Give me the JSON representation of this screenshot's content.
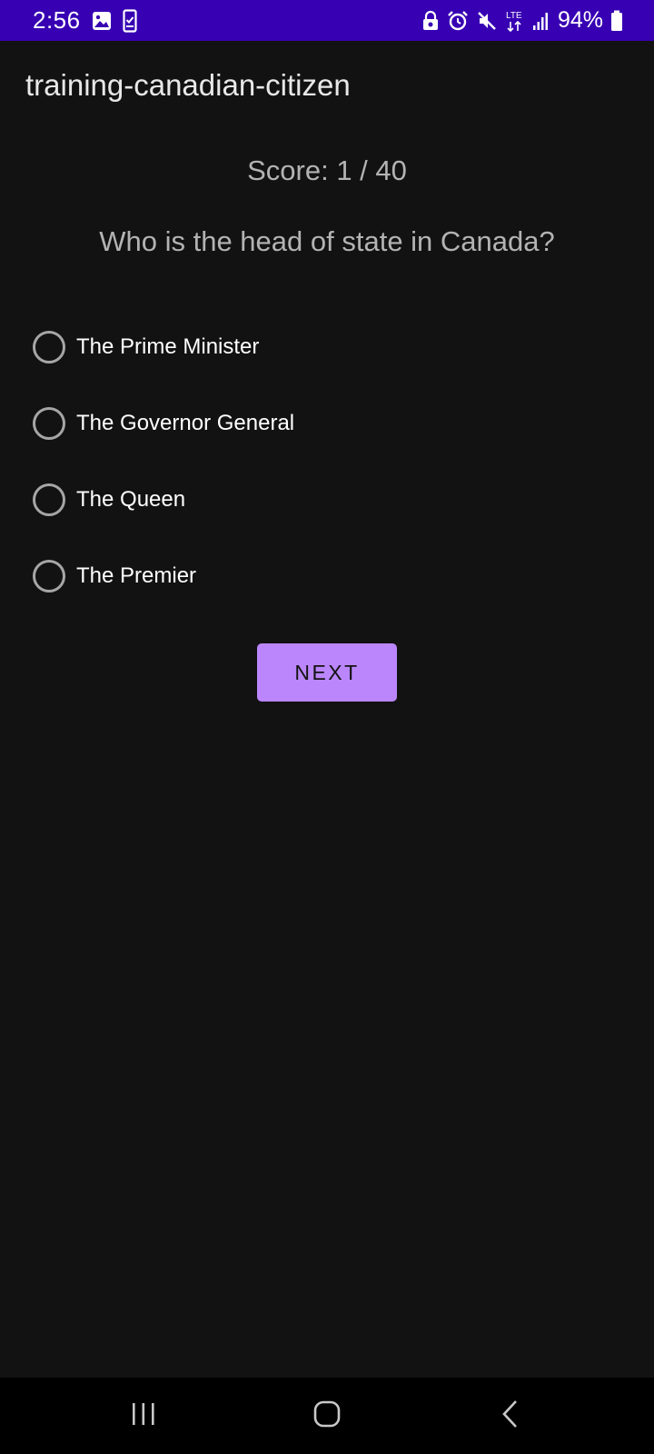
{
  "status_bar": {
    "time": "2:56",
    "battery_text": "94%",
    "network_label": "LTE",
    "left_icons": [
      "image-icon",
      "device-check-icon"
    ],
    "right_icons": [
      "vpn-lock-icon",
      "alarm-icon",
      "mute-icon",
      "lte-data-icon",
      "signal-icon",
      "battery-icon"
    ]
  },
  "app_bar": {
    "title": "training-canadian-citizen"
  },
  "quiz": {
    "score": "Score: 1 / 40",
    "question": "Who is the head of state in Canada?",
    "options": [
      {
        "label": "The Prime Minister",
        "selected": false
      },
      {
        "label": "The Governor General",
        "selected": false
      },
      {
        "label": "The Queen",
        "selected": false
      },
      {
        "label": "The Premier",
        "selected": false
      }
    ],
    "next_label": "NEXT"
  },
  "nav_bar": {
    "buttons": [
      "recent-apps-icon",
      "home-icon",
      "back-icon"
    ]
  },
  "colors": {
    "status_bar": "#3700b3",
    "background": "#121212",
    "accent": "#bb86fc"
  }
}
